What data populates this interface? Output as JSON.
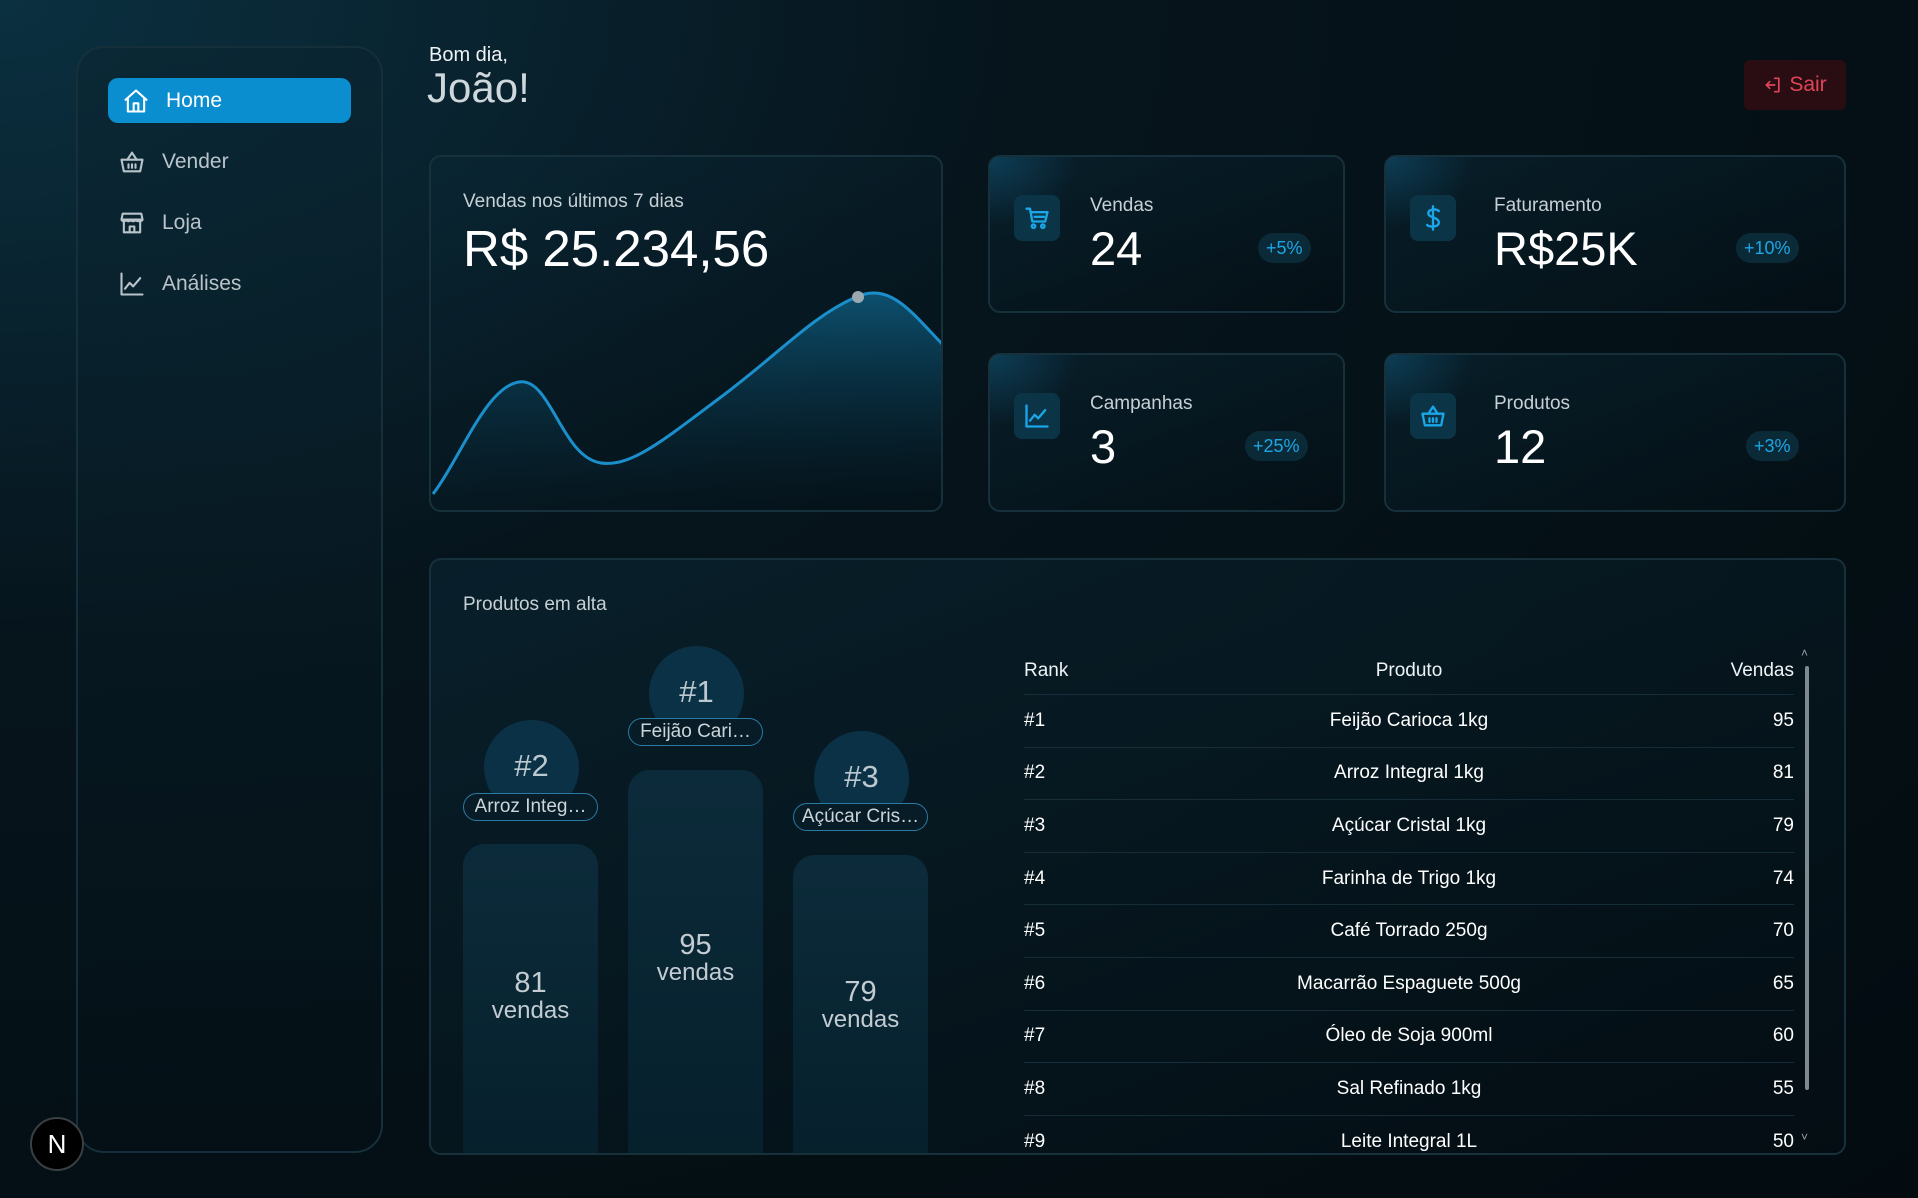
{
  "sidebar": {
    "items": [
      {
        "label": "Home",
        "icon": "home-icon",
        "active": true
      },
      {
        "label": "Vender",
        "icon": "basket-icon"
      },
      {
        "label": "Loja",
        "icon": "store-icon"
      },
      {
        "label": "Análises",
        "icon": "chart-line-icon"
      }
    ]
  },
  "header": {
    "greeting": "Bom dia,",
    "name": "João!",
    "logout_label": "Sair"
  },
  "sales_card": {
    "label": "Vendas nos últimos 7 dias",
    "value": "R$ 25.234,56"
  },
  "stats": {
    "vendas": {
      "label": "Vendas",
      "value": "24",
      "change": "+5%",
      "icon": "cart-icon"
    },
    "faturamento": {
      "label": "Faturamento",
      "value": "R$25K",
      "change": "+10%",
      "icon": "dollar-icon"
    },
    "campanhas": {
      "label": "Campanhas",
      "value": "3",
      "change": "+25%",
      "icon": "chart-line-icon"
    },
    "produtos": {
      "label": "Produtos",
      "value": "12",
      "change": "+3%",
      "icon": "basket-icon"
    }
  },
  "top_products": {
    "title": "Produtos em alta",
    "podium": [
      {
        "rank": "#2",
        "name": "Arroz Integ…",
        "sales": "81",
        "unit": "vendas"
      },
      {
        "rank": "#1",
        "name": "Feijão Cari…",
        "sales": "95",
        "unit": "vendas"
      },
      {
        "rank": "#3",
        "name": "Açúcar Cris…",
        "sales": "79",
        "unit": "vendas"
      }
    ],
    "table": {
      "headers": {
        "rank": "Rank",
        "product": "Produto",
        "sales": "Vendas"
      },
      "rows": [
        {
          "rank": "#1",
          "product": "Feijão Carioca 1kg",
          "sales": "95"
        },
        {
          "rank": "#2",
          "product": "Arroz Integral 1kg",
          "sales": "81"
        },
        {
          "rank": "#3",
          "product": "Açúcar Cristal 1kg",
          "sales": "79"
        },
        {
          "rank": "#4",
          "product": "Farinha de Trigo 1kg",
          "sales": "74"
        },
        {
          "rank": "#5",
          "product": "Café Torrado 250g",
          "sales": "70"
        },
        {
          "rank": "#6",
          "product": "Macarrão Espaguete 500g",
          "sales": "65"
        },
        {
          "rank": "#7",
          "product": "Óleo de Soja 900ml",
          "sales": "60"
        },
        {
          "rank": "#8",
          "product": "Sal Refinado 1kg",
          "sales": "55"
        },
        {
          "rank": "#9",
          "product": "Leite Integral 1L",
          "sales": "50"
        }
      ]
    }
  },
  "footer": {
    "logo_letter": "N"
  },
  "colors": {
    "accent": "#0a8ecf",
    "badge_text": "#1ca6e6",
    "logout": "#e04557"
  }
}
